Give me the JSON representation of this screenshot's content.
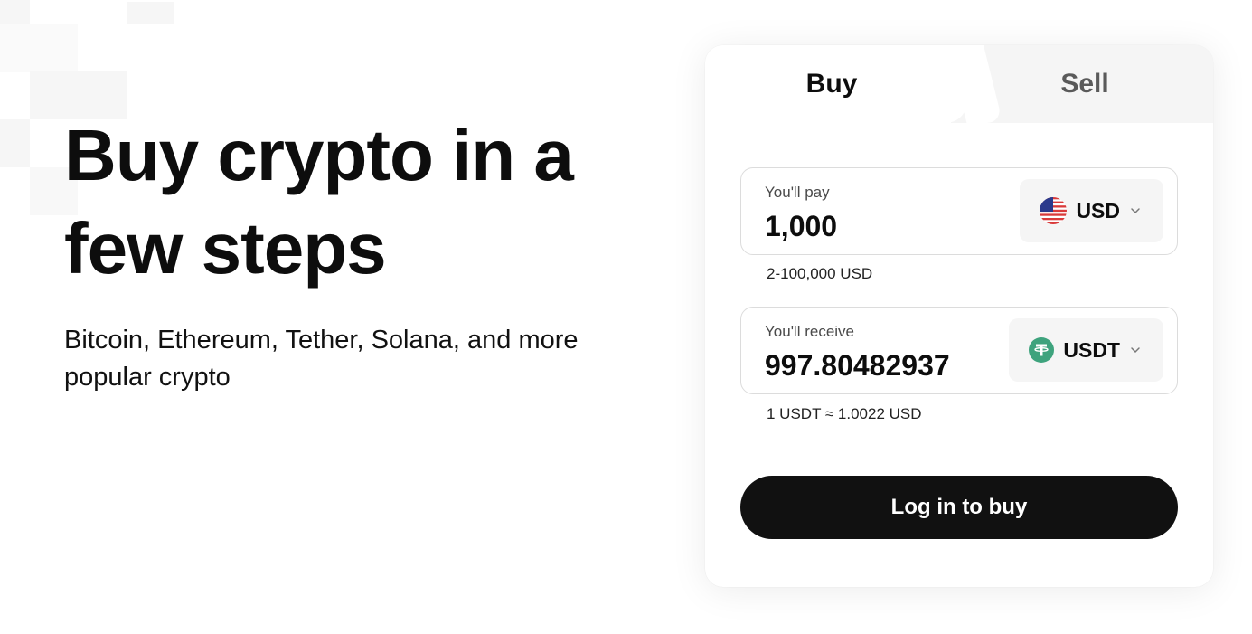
{
  "hero": {
    "title_line1": "Buy crypto in a",
    "title_line2": "few steps",
    "subtitle_line1": "Bitcoin, Ethereum, Tether, Solana, and more",
    "subtitle_line2": "popular crypto"
  },
  "tabs": [
    {
      "label": "Buy",
      "active": true
    },
    {
      "label": "Sell",
      "active": false
    }
  ],
  "pay": {
    "label": "You'll pay",
    "value": "1,000",
    "currency": "USD",
    "currency_icon": "us-flag-icon",
    "range_hint": "2-100,000 USD"
  },
  "receive": {
    "label": "You'll receive",
    "value": "997.80482937",
    "currency": "USDT",
    "currency_icon": "tether-icon",
    "rate_hint": "1 USDT ≈ 1.0022 USD"
  },
  "action": {
    "label": "Log in to buy"
  },
  "colors": {
    "button_bg": "#111111",
    "tether_green": "#3ea37d",
    "flag_blue": "#2b3a8c",
    "flag_red": "#d93a3a"
  }
}
